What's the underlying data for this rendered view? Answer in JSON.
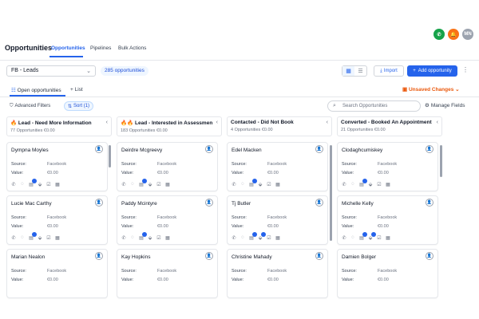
{
  "header": {
    "title": "Opportunities",
    "tabs": [
      "Opportunities",
      "Pipelines",
      "Bulk Actions"
    ],
    "avatar_initials": "MN"
  },
  "toolbar": {
    "pipeline": "FB - Leads",
    "count": "285 opportunities",
    "import_label": "Import",
    "add_label": "Add opportunity"
  },
  "subtabs": {
    "open": "Open opportunities",
    "list": "List",
    "unsaved": "Unsaved Changes"
  },
  "filters": {
    "advanced": "Advanced Filters",
    "sort": "Sort (1)",
    "search_placeholder": "Search Opportunities",
    "manage": "Manage Fields"
  },
  "columns": [
    {
      "title": "🔥 Lead - Need More Information",
      "meta": "77 Opportunities  €0.00",
      "cards": [
        {
          "name": "Dympna Moyles",
          "source": "Facebook",
          "value": "€0.00"
        },
        {
          "name": "Lucie Mac Carthy",
          "source": "Facebook",
          "value": "€0.00"
        },
        {
          "name": "Marian Nealon",
          "source": "Facebook",
          "value": "€0.00"
        }
      ]
    },
    {
      "title": "🔥🔥 Lead - Interested in Assessmen",
      "meta": "183 Opportunities  €0.00",
      "cards": [
        {
          "name": "Deirdre Mcgreevy",
          "source": "Facebook",
          "value": "€0.00"
        },
        {
          "name": "Paddy Mcintyre",
          "source": "Facebook",
          "value": "€0.00"
        },
        {
          "name": "Kay Hopkins",
          "source": "Facebook",
          "value": "€0.00"
        }
      ]
    },
    {
      "title": "Contacted - Did Not Book",
      "meta": "4 Opportunities  €0.00",
      "cards": [
        {
          "name": "Edel Macken",
          "source": "Facebook",
          "value": "€0.00"
        },
        {
          "name": "Tj Butler",
          "source": "Facebook",
          "value": "€0.00"
        },
        {
          "name": "Christine Mahady",
          "source": "Facebook",
          "value": "€0.00"
        }
      ]
    },
    {
      "title": "Converted - Booked An Appointment",
      "meta": "21 Opportunities  €0.00",
      "cards": [
        {
          "name": "Clodaghcumiskey",
          "source": "Facebook",
          "value": "€0.00"
        },
        {
          "name": "Michelle Kelly",
          "source": "Facebook",
          "value": "€0.00"
        },
        {
          "name": "Damien Bolger",
          "source": "Facebook",
          "value": "€0.00"
        }
      ]
    }
  ],
  "card_labels": {
    "source": "Source:",
    "value": "Value:"
  },
  "colors": {
    "accent": "#2563eb",
    "phone": "#16a34a",
    "bell": "#f97316",
    "avatar": "#9ca3af",
    "unsaved": "#ea580c"
  }
}
